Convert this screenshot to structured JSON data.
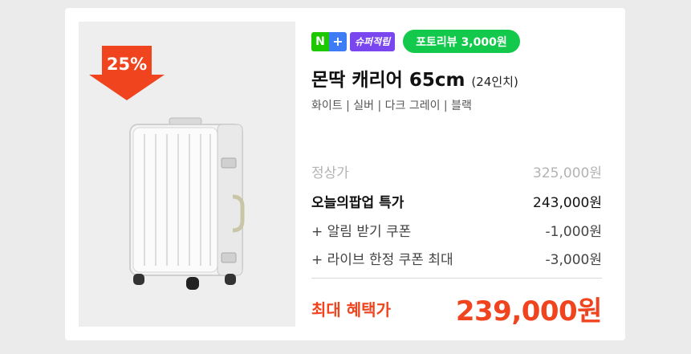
{
  "product": {
    "discount_badge": "25%",
    "npay_n": "N",
    "npay_plus": "+",
    "super_badge": "슈퍼적립",
    "review_pill": "포토리뷰  3,000원",
    "title": "몬딱 캐리어 65cm",
    "title_size": "(24인치)",
    "colors": "화이트 | 실버 | 다크 그레이 | 블랙"
  },
  "pricing": {
    "regular_label": "정상가",
    "regular_value": "325,000원",
    "special_label": "오늘의팝업 특가",
    "special_value": "243,000원",
    "coupon1_label": "+ 알림 받기 쿠폰",
    "coupon1_value": "-1,000원",
    "coupon2_label": "+ 라이브 한정 쿠폰 최대",
    "coupon2_value": "-3,000원",
    "final_label": "최대 혜택가",
    "final_value": "239,000원"
  },
  "colors": {
    "accent": "#f0441f",
    "naver_green": "#1ec800",
    "review_green": "#12c94c",
    "super_purple": "#7a46f0"
  },
  "icons": [
    "npay-plus-icon",
    "down-arrow-badge-icon",
    "suitcase-image"
  ]
}
